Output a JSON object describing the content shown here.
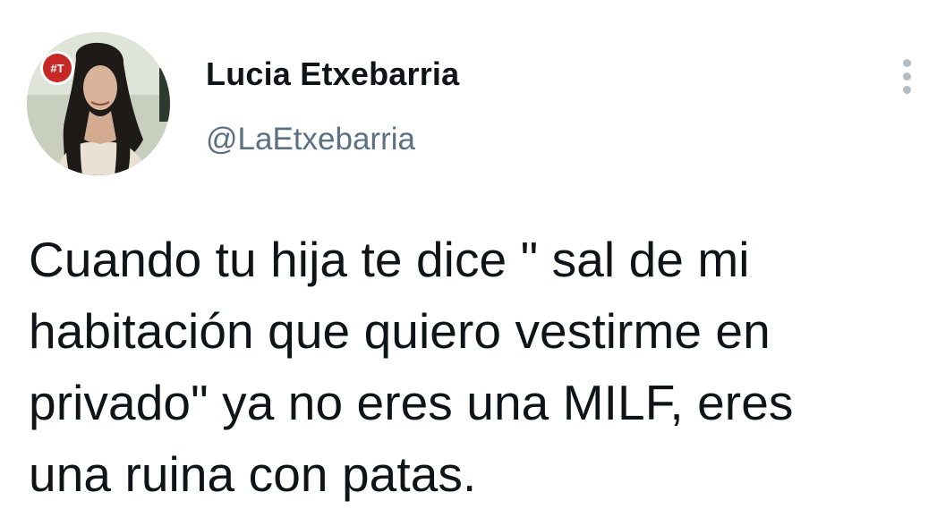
{
  "author": {
    "display_name": "Lucia Etxebarria",
    "handle": "@LaEtxebarria",
    "avatar_icon": "profile-photo",
    "badge_text": "#T",
    "badge_color": "#c62828"
  },
  "tweet": {
    "lines": [
      "Cuando tu hija te dice \" sal de mi",
      "habitación que quiero vestirme en",
      "privado\" ya no eres una MILF, eres",
      "una ruina con patas."
    ]
  },
  "menu": {
    "icon": "more-vertical-icon"
  },
  "colors": {
    "text": "#0f1419",
    "secondary": "#5b7083",
    "menu_dots": "#b3bdc6"
  }
}
